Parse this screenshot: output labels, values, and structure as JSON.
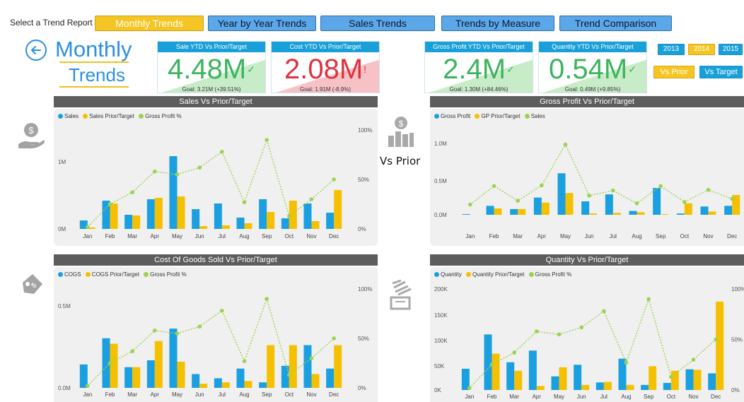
{
  "nav": {
    "label": "Select a Trend Report",
    "buttons": [
      "Monthly Trends",
      "Year by Year Trends",
      "Sales Trends",
      "Trends by Measure",
      "Trend Comparison"
    ],
    "active": 0
  },
  "title": {
    "line1": "Monthly",
    "line2": "Trends"
  },
  "kpis": [
    {
      "head": "Sale YTD Vs Prior/Target",
      "value": "4.48M",
      "goal": "Goal: 3.21M (+39.51%)",
      "status": "good"
    },
    {
      "head": "Cost YTD Vs Prior/Target",
      "value": "2.08M",
      "goal": "Goal: 1.91M (-8.9%)",
      "status": "bad"
    },
    {
      "head": "Gross Profit YTD Vs Prior/Target",
      "value": "2.4M",
      "goal": "Goal: 1.30M (+84.46%)",
      "status": "good"
    },
    {
      "head": "Quantity YTD Vs Prior/Target",
      "value": "0.54M",
      "goal": "Goal: 0.49M (+9.85%)",
      "status": "good"
    }
  ],
  "years": {
    "options": [
      "2013",
      "2014",
      "2015"
    ],
    "selected": "2014"
  },
  "compare": {
    "options": [
      "Vs Prior",
      "Vs Target"
    ],
    "selected": "Vs Prior"
  },
  "mode_label": "Vs Prior",
  "colors": {
    "series1": "#1aa0e0",
    "series2": "#f5c000",
    "series3": "#9bd34f",
    "nav": "#5ba7e8",
    "active": "#f5c623",
    "bad": "#e0313d",
    "good": "#3bb45c"
  },
  "icons": [
    "arrow-left-circle-icon",
    "money-hand-icon",
    "price-tag-icon",
    "dollar-bars-icon",
    "stacked-boxes-icon"
  ],
  "chart_data": [
    {
      "type": "bar",
      "title": "Sales Vs Prior/Target",
      "categories": [
        "Jan",
        "Feb",
        "Mar",
        "Apr",
        "May",
        "Jun",
        "Jul",
        "Aug",
        "Sep",
        "Oct",
        "Nov",
        "Dec"
      ],
      "series": [
        {
          "name": "Sales",
          "values": [
            0.12,
            0.4,
            0.2,
            0.42,
            1.03,
            0.28,
            0.36,
            0.16,
            0.42,
            0.15,
            0.36,
            0.23
          ]
        },
        {
          "name": "Sales Prior/Target",
          "values": [
            0.02,
            0.36,
            0.19,
            0.44,
            0.46,
            0.04,
            0.05,
            0.08,
            0.24,
            0.4,
            0.11,
            0.55
          ]
        }
      ],
      "line": {
        "name": "Gross Profit %",
        "values": [
          2,
          25,
          37,
          58,
          55,
          62,
          78,
          27,
          90,
          13,
          30,
          50
        ]
      },
      "y_ticks": [
        "0M",
        "1M"
      ],
      "ylim": [
        0,
        1.2
      ],
      "y2_ticks": [
        "0%",
        "50%",
        "100%"
      ],
      "y2lim": [
        0,
        100
      ]
    },
    {
      "type": "bar",
      "title": "Gross Profit Vs Prior/Target",
      "categories": [
        "Jan",
        "Feb",
        "Mar",
        "Apr",
        "May",
        "Jun",
        "Jul",
        "Aug",
        "Sep",
        "Oct",
        "Nov",
        "Dec"
      ],
      "series": [
        {
          "name": "Gross Profit",
          "values": [
            0.01,
            0.14,
            0.09,
            0.27,
            0.65,
            0.21,
            0.32,
            0.06,
            0.42,
            0.02,
            0.13,
            0.14
          ]
        },
        {
          "name": "GP Prior/Target",
          "values": [
            0.0,
            0.1,
            0.09,
            0.19,
            0.34,
            0.02,
            0.03,
            0.04,
            0.01,
            0.18,
            0.05,
            0.31
          ]
        }
      ],
      "line": {
        "name": "Sales",
        "values": [
          0.16,
          0.45,
          0.22,
          0.46,
          1.1,
          0.3,
          0.38,
          0.18,
          0.45,
          0.2,
          0.39,
          0.25
        ]
      },
      "y_ticks": [
        "0.0M",
        "0.5M",
        "1.0M"
      ],
      "ylim": [
        0,
        1.25
      ]
    },
    {
      "type": "bar",
      "title": "Cost Of Goods Sold Vs Prior/Target",
      "categories": [
        "Jan",
        "Feb",
        "Mar",
        "Apr",
        "May",
        "Jun",
        "Jul",
        "Aug",
        "Sep",
        "Oct",
        "Nov",
        "Dec"
      ],
      "series": [
        {
          "name": "COGS",
          "values": [
            0.17,
            0.36,
            0.15,
            0.2,
            0.43,
            0.1,
            0.07,
            0.14,
            0.04,
            0.16,
            0.31,
            0.14
          ]
        },
        {
          "name": "COGS Prior/Target",
          "values": [
            0.0,
            0.32,
            0.15,
            0.34,
            0.19,
            0.03,
            0.04,
            0.05,
            0.31,
            0.31,
            0.1,
            0.31
          ]
        }
      ],
      "line": {
        "name": "Gross Profit %",
        "values": [
          2,
          25,
          37,
          58,
          55,
          62,
          78,
          27,
          90,
          13,
          30,
          50
        ]
      },
      "y_ticks": [
        "0.0M",
        "0.5M"
      ],
      "ylim": [
        0,
        0.62
      ],
      "y2_ticks": [
        "0%",
        "50%",
        "100%"
      ],
      "y2lim": [
        0,
        100
      ]
    },
    {
      "type": "bar",
      "title": "Quantity Vs Prior/Target",
      "categories": [
        "Jan",
        "Feb",
        "Mar",
        "Apr",
        "May",
        "Jun",
        "Jul",
        "Aug",
        "Sep",
        "Oct",
        "Nov",
        "Dec"
      ],
      "series": [
        {
          "name": "Quantity",
          "values": [
            42000,
            110000,
            55000,
            78000,
            27000,
            50000,
            15000,
            62000,
            10000,
            14000,
            41000,
            33000
          ]
        },
        {
          "name": "Quantity Prior/Target",
          "values": [
            0,
            72000,
            38000,
            8000,
            45000,
            10000,
            16000,
            10000,
            47000,
            38000,
            40000,
            175000
          ]
        }
      ],
      "line": {
        "name": "Gross Profit %",
        "values": [
          2,
          25,
          37,
          58,
          55,
          62,
          78,
          27,
          90,
          13,
          30,
          50
        ]
      },
      "y_ticks": [
        "0K",
        "50K",
        "100K",
        "150K",
        "200K"
      ],
      "ylim": [
        0,
        200000
      ],
      "y2_ticks": [
        "0%",
        "50%",
        "100%"
      ],
      "y2lim": [
        0,
        100
      ]
    }
  ]
}
